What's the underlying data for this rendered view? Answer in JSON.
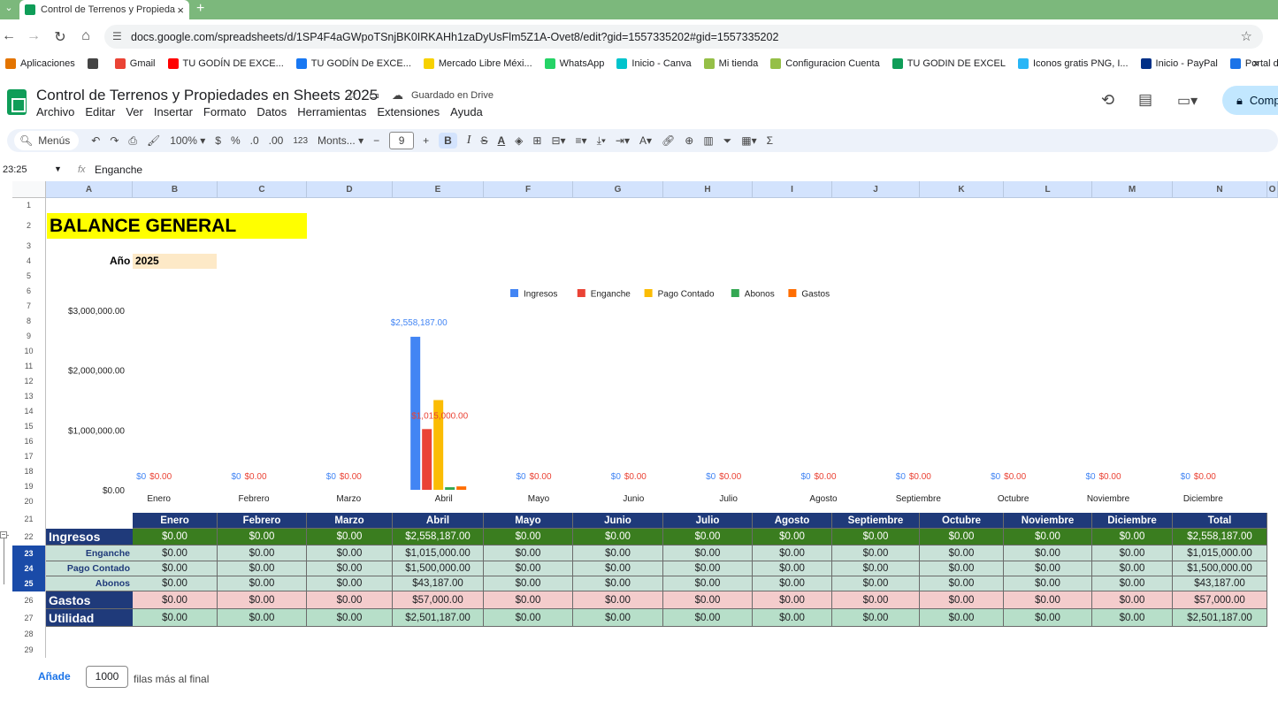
{
  "browser": {
    "tab_title": "Control de Terrenos y Propieda",
    "url": "docs.google.com/spreadsheets/d/1SP4F4aGWpoTSnjBK0IRKAHh1zaDyUsFlm5Z1A-Ovet8/edit?gid=1557335202#gid=1557335202",
    "bookmarks": [
      {
        "label": "Aplicaciones",
        "color": "#e37400"
      },
      {
        "label": "",
        "color": "#444444"
      },
      {
        "label": "Gmail",
        "color": "#ea4335"
      },
      {
        "label": "TU GODÍN DE EXCE...",
        "color": "#ff0000"
      },
      {
        "label": "TU GODÍN De EXCE...",
        "color": "#1877f2"
      },
      {
        "label": "Mercado Libre Méxi...",
        "color": "#f7d100"
      },
      {
        "label": "WhatsApp",
        "color": "#25d366"
      },
      {
        "label": "Inicio - Canva",
        "color": "#00c4cc"
      },
      {
        "label": "Mi tienda",
        "color": "#95bf47"
      },
      {
        "label": "Configuracion Cuenta",
        "color": "#95bf47"
      },
      {
        "label": "TU GODIN DE EXCEL",
        "color": "#0f9d58"
      },
      {
        "label": "Iconos gratis PNG, I...",
        "color": "#29b6f6"
      },
      {
        "label": "Inicio - PayPal",
        "color": "#003087"
      },
      {
        "label": "Portal de Trámites y...",
        "color": "#1a73e8"
      }
    ],
    "more": "»"
  },
  "doc": {
    "title": "Control de Terrenos y Propiedades en Sheets 2025",
    "saved": "Guardado en Drive",
    "share": "Comp",
    "menus": [
      "Archivo",
      "Editar",
      "Ver",
      "Insertar",
      "Formato",
      "Datos",
      "Herramientas",
      "Extensiones",
      "Ayuda"
    ]
  },
  "toolbar": {
    "menus_label": "Menús",
    "zoom": "100%",
    "currency": "$",
    "percent": "%",
    "dec_minus": ".0",
    "dec_plus": ".00",
    "format_123": "123",
    "font": "Monts...",
    "font_size": "9",
    "bold": "B",
    "italic": "I",
    "strike": "S",
    "text_color": "A"
  },
  "formula_bar": {
    "namebox": "23:25",
    "fx": "fx",
    "content": "Enganche"
  },
  "columns": [
    "A",
    "B",
    "C",
    "D",
    "E",
    "F",
    "G",
    "H",
    "I",
    "J",
    "K",
    "L",
    "M",
    "N",
    "O"
  ],
  "rows": [
    "1",
    "2",
    "3",
    "4",
    "5",
    "6",
    "7",
    "8",
    "9",
    "10",
    "11",
    "12",
    "13",
    "14",
    "15",
    "16",
    "17",
    "18",
    "19",
    "20",
    "21",
    "22",
    "23",
    "24",
    "25",
    "26",
    "27",
    "28",
    "29"
  ],
  "sheet": {
    "title": "BALANCE GENERAL",
    "year_label": "Año",
    "year_value": "2025"
  },
  "chart_data": {
    "type": "bar",
    "categories": [
      "Enero",
      "Febrero",
      "Marzo",
      "Abril",
      "Mayo",
      "Junio",
      "Julio",
      "Agosto",
      "Septiembre",
      "Octubre",
      "Noviembre",
      "Diciembre"
    ],
    "series": [
      {
        "name": "Ingresos",
        "color": "#4285f4",
        "values": [
          0,
          0,
          0,
          2558187,
          0,
          0,
          0,
          0,
          0,
          0,
          0,
          0
        ]
      },
      {
        "name": "Enganche",
        "color": "#ea4335",
        "values": [
          0,
          0,
          0,
          1015000,
          0,
          0,
          0,
          0,
          0,
          0,
          0,
          0
        ]
      },
      {
        "name": "Pago Contado",
        "color": "#fbbc04",
        "values": [
          0,
          0,
          0,
          1500000,
          0,
          0,
          0,
          0,
          0,
          0,
          0,
          0
        ]
      },
      {
        "name": "Abonos",
        "color": "#34a853",
        "values": [
          0,
          0,
          0,
          43187,
          0,
          0,
          0,
          0,
          0,
          0,
          0,
          0
        ]
      },
      {
        "name": "Gastos",
        "color": "#ff6d01",
        "values": [
          0,
          0,
          0,
          57000,
          0,
          0,
          0,
          0,
          0,
          0,
          0,
          0
        ]
      }
    ],
    "data_labels": {
      "Ingresos": [
        "$0",
        "$0",
        "$0",
        "$2,558,187.00",
        "$0",
        "$0",
        "$0",
        "$0",
        "$0",
        "$0",
        "$0",
        "$0"
      ],
      "Enganche": [
        "$0.00",
        "$0.00",
        "$0.00",
        "$1,015,000.00",
        "$0.00",
        "$0.00",
        "$0.00",
        "$0.00",
        "$0.00",
        "$0.00",
        "$0.00",
        "$0.00"
      ]
    },
    "yticks": [
      "$0.00",
      "$1,000,000.00",
      "$2,000,000.00",
      "$3,000,000.00"
    ],
    "ylim": [
      0,
      3000000
    ],
    "legend": "top"
  },
  "table": {
    "headers": [
      "Enero",
      "Febrero",
      "Marzo",
      "Abril",
      "Mayo",
      "Junio",
      "Julio",
      "Agosto",
      "Septiembre",
      "Octubre",
      "Noviembre",
      "Diciembre",
      "Total"
    ],
    "rows": [
      {
        "label": "Ingresos",
        "cls": "ing",
        "values": [
          "$0.00",
          "$0.00",
          "$0.00",
          "$2,558,187.00",
          "$0.00",
          "$0.00",
          "$0.00",
          "$0.00",
          "$0.00",
          "$0.00",
          "$0.00",
          "$0.00",
          "$2,558,187.00"
        ]
      },
      {
        "label": "Enganche",
        "cls": "sub",
        "values": [
          "$0.00",
          "$0.00",
          "$0.00",
          "$1,015,000.00",
          "$0.00",
          "$0.00",
          "$0.00",
          "$0.00",
          "$0.00",
          "$0.00",
          "$0.00",
          "$0.00",
          "$1,015,000.00"
        ]
      },
      {
        "label": "Pago Contado",
        "cls": "sub",
        "values": [
          "$0.00",
          "$0.00",
          "$0.00",
          "$1,500,000.00",
          "$0.00",
          "$0.00",
          "$0.00",
          "$0.00",
          "$0.00",
          "$0.00",
          "$0.00",
          "$0.00",
          "$1,500,000.00"
        ]
      },
      {
        "label": "Abonos",
        "cls": "sub",
        "values": [
          "$0.00",
          "$0.00",
          "$0.00",
          "$43,187.00",
          "$0.00",
          "$0.00",
          "$0.00",
          "$0.00",
          "$0.00",
          "$0.00",
          "$0.00",
          "$0.00",
          "$43,187.00"
        ]
      },
      {
        "label": "Gastos",
        "cls": "gas",
        "values": [
          "$0.00",
          "$0.00",
          "$0.00",
          "$57,000.00",
          "$0.00",
          "$0.00",
          "$0.00",
          "$0.00",
          "$0.00",
          "$0.00",
          "$0.00",
          "$0.00",
          "$57,000.00"
        ]
      },
      {
        "label": "Utilidad",
        "cls": "uti",
        "values": [
          "$0.00",
          "$0.00",
          "$0.00",
          "$2,501,187.00",
          "$0.00",
          "$0.00",
          "$0.00",
          "$0.00",
          "$0.00",
          "$0.00",
          "$0.00",
          "$0.00",
          "$2,501,187.00"
        ]
      }
    ]
  },
  "footer": {
    "add_label": "Añade",
    "add_count": "1000",
    "add_suffix": "filas más al final"
  }
}
